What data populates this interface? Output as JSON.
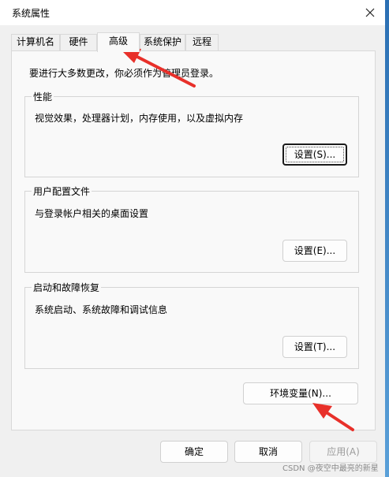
{
  "window": {
    "title": "系统属性"
  },
  "tabs": [
    {
      "label": "计算机名"
    },
    {
      "label": "硬件"
    },
    {
      "label": "高级"
    },
    {
      "label": "系统保护"
    },
    {
      "label": "远程"
    }
  ],
  "notice": "要进行大多数更改，你必须作为管理员登录。",
  "performance": {
    "title": "性能",
    "description": "视觉效果，处理器计划，内存使用，以及虚拟内存",
    "settings_button": "设置(S)..."
  },
  "user_profiles": {
    "title": "用户配置文件",
    "description": "与登录帐户相关的桌面设置",
    "settings_button": "设置(E)..."
  },
  "startup_recovery": {
    "title": "启动和故障恢复",
    "description": "系统启动、系统故障和调试信息",
    "settings_button": "设置(T)..."
  },
  "env_vars_button": "环境变量(N)...",
  "footer": {
    "ok": "确定",
    "cancel": "取消",
    "apply": "应用(A)"
  },
  "watermark": "CSDN @夜空中最亮的新星",
  "colors": {
    "annotation_arrow": "#e8302a"
  }
}
